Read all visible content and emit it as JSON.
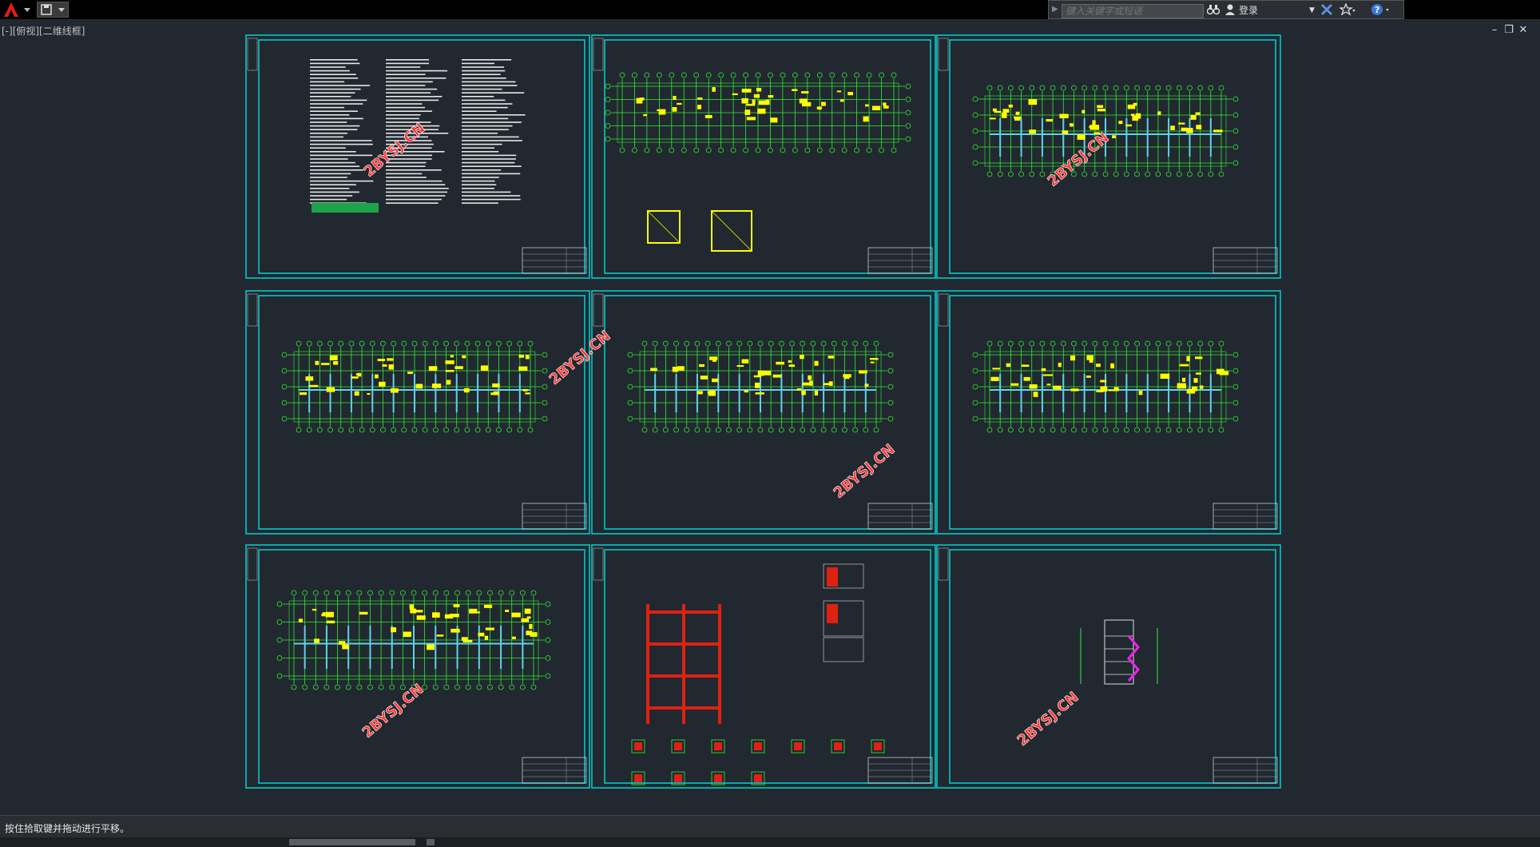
{
  "toolbar": {
    "search_placeholder": "键入关键字或短语",
    "login_label": "登录",
    "icons": [
      "autocad-logo-icon",
      "save-icon",
      "binoculars-icon",
      "user-icon",
      "exchange-icon",
      "star-icon",
      "help-icon"
    ]
  },
  "canvas": {
    "view_label": "[-][俯视][二维线框]",
    "window_controls": [
      "minimize-icon",
      "restore-icon",
      "close-icon"
    ],
    "watermark": "2BYSJ.CN",
    "colors": {
      "background": "#212830",
      "frame": "#00d2d2",
      "grid": "#33ee33",
      "text": "#ffff00",
      "column": "#5fd3ea",
      "frame_elements": "#dd2211",
      "magenta": "#ee22ee"
    }
  },
  "status": {
    "message": "按住拾取键并拖动进行平移。"
  }
}
